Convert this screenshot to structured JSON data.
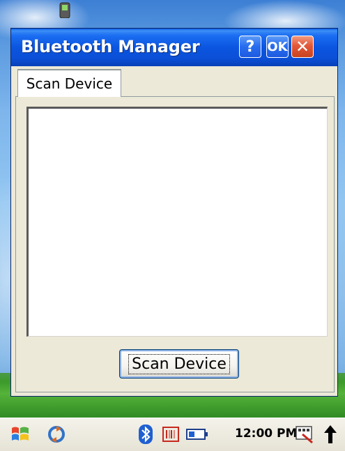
{
  "window": {
    "title": "Bluetooth Manager",
    "help_label": "?",
    "ok_label": "OK",
    "close_label": "✕"
  },
  "tabs": [
    {
      "label": "Scan Device",
      "selected": true
    }
  ],
  "device_list": {
    "items": []
  },
  "actions": {
    "scan_button_label": "Scan Device"
  },
  "taskbar": {
    "clock": "12:00 PM",
    "icons": [
      "windows-start-icon",
      "sync-icon",
      "bluetooth-icon",
      "barcode-scanner-icon",
      "battery-icon",
      "input-panel-icon",
      "arrow-up-icon"
    ]
  },
  "colors": {
    "title_bar": "#0b55e0",
    "window_background": "#ece9d8",
    "close_button": "#e2583a"
  }
}
